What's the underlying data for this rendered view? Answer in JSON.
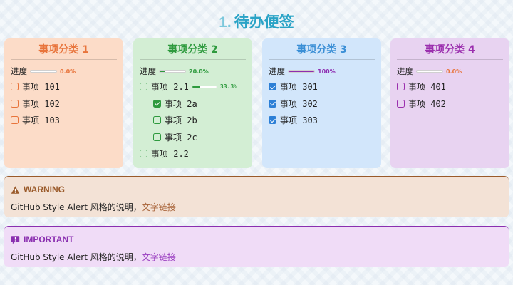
{
  "header": {
    "number": "1.",
    "title": "待办便签"
  },
  "progress_label": "进度",
  "cards": [
    {
      "title": "事项分类 1",
      "color": "#e8743b",
      "bg": "#fcdcc8",
      "progress": 0,
      "progress_text": "0.0%",
      "items": [
        {
          "label": "事项 101",
          "checked": false
        },
        {
          "label": "事项 102",
          "checked": false
        },
        {
          "label": "事项 103",
          "checked": false
        }
      ]
    },
    {
      "title": "事项分类 2",
      "color": "#2e9a3e",
      "bg": "#d3eed4",
      "progress": 0.2,
      "progress_text": "20.0%",
      "items": [
        {
          "label": "事项 2.1",
          "checked": false,
          "progress": 0.333,
          "progress_text": "33.3%"
        },
        {
          "label": "事项 2a",
          "checked": true,
          "sub": true
        },
        {
          "label": "事项 2b",
          "checked": false,
          "sub": true
        },
        {
          "label": "事项 2c",
          "checked": false,
          "sub": true
        },
        {
          "label": "事项 2.2",
          "checked": false
        }
      ]
    },
    {
      "title": "事项分类 3",
      "color": "#3b8fd6",
      "bg": "#d2e6fb",
      "bar_color": "#8e2db0",
      "pct_color": "#8e2db0",
      "progress": 1,
      "progress_text": "100%",
      "items": [
        {
          "label": "事项 301",
          "checked": true
        },
        {
          "label": "事项 302",
          "checked": true
        },
        {
          "label": "事项 303",
          "checked": true
        }
      ]
    },
    {
      "title": "事项分类 4",
      "color": "#9b2fae",
      "bg": "#e8d3f1",
      "pct_color": "#e8743b",
      "progress": 0,
      "progress_text": "0.0%",
      "items": [
        {
          "label": "事项 401",
          "checked": false
        },
        {
          "label": "事项 402",
          "checked": false
        }
      ]
    }
  ],
  "alerts": [
    {
      "kind": "warning",
      "title": "WARNING",
      "icon": "warning-icon",
      "color": "#9a5a2a",
      "bg": "#f3e2d6",
      "border": "#9a5a2a",
      "text": "GitHub Style Alert 风格的说明，",
      "link": "文字链接",
      "link_color": "#a8643a"
    },
    {
      "kind": "important",
      "title": "IMPORTANT",
      "icon": "important-icon",
      "color": "#8a2fb0",
      "bg": "#f0dcf7",
      "border": "#8a2fb0",
      "text": "GitHub Style Alert 风格的说明，",
      "link": "文字链接",
      "link_color": "#9a3fc0"
    }
  ]
}
